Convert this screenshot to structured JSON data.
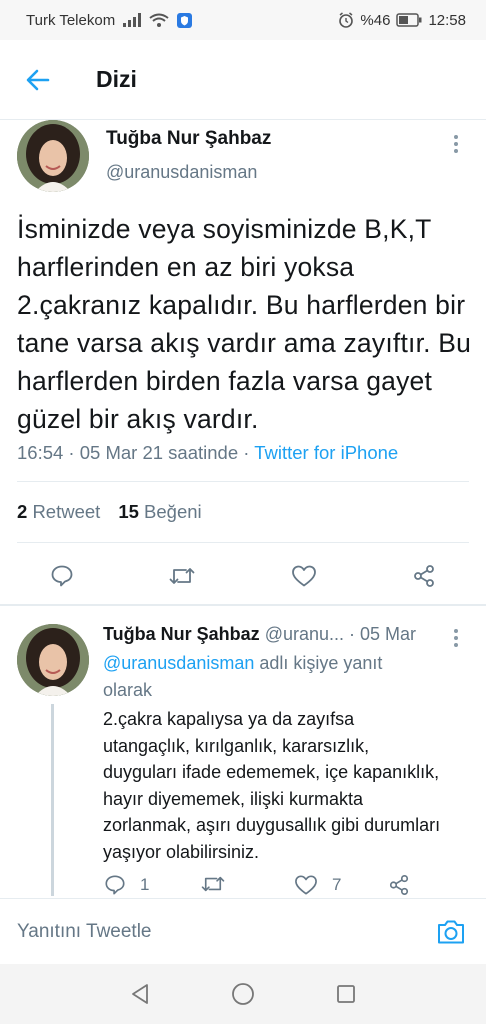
{
  "status_bar": {
    "carrier": "Turk Telekom",
    "battery": "%46",
    "time": "12:58"
  },
  "header": {
    "title": "Dizi",
    "back_icon": "arrow-left-icon"
  },
  "tweet": {
    "author_name": "Tuğba Nur Şahbaz",
    "author_handle": "@uranusdanisman",
    "text": "İsminizde veya soyisminizde B,K,T harflerinden en az biri yoksa 2.çakranız kapalıdır. Bu harflerden bir tane varsa akış vardır ama zayıftır. Bu harflerden birden fazla varsa gayet güzel bir akış vardır.",
    "time": "16:54 · 05 Mar 21 saatinde · ",
    "source": "Twitter for iPhone",
    "retweets_count": "2",
    "retweets_label": "Retweet",
    "likes_count": "15",
    "likes_label": "Beğeni"
  },
  "reply": {
    "author_name": "Tuğba Nur Şahbaz",
    "author_handle": "@uranu...",
    "date": "· 05 Mar",
    "reply_to_mention": "@uranusdanisman",
    "reply_to_suffix": "adlı kişiye yanıt olarak",
    "text": "2.çakra kapalıysa ya da zayıfsa utangaçlık, kırılganlık, kararsızlık, duyguları ifade edememek, içe kapanıklık, hayır diyememek, ilişki kurmakta zorlanmak, aşırı duygusallık gibi durumları yaşıyor olabilirsiniz.",
    "reply_count": "1",
    "like_count": "7"
  },
  "compose": {
    "placeholder": "Yanıtını Tweetle"
  },
  "colors": {
    "accent": "#1da1f2",
    "secondary_text": "#657786",
    "divider": "#e6ecf0"
  }
}
